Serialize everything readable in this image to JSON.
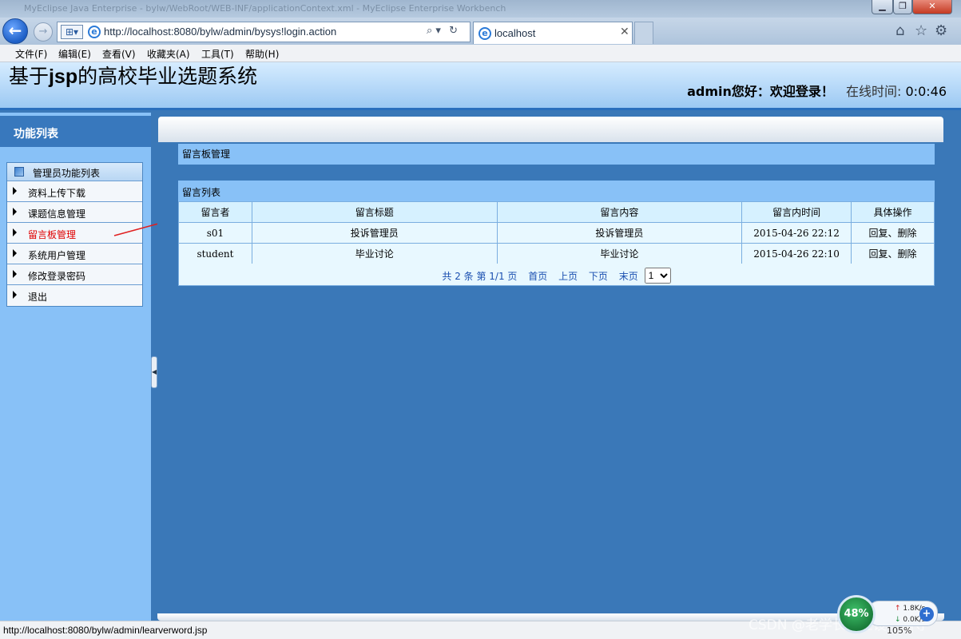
{
  "browser": {
    "window_title": "MyEclipse Java Enterprise - bylw/WebRoot/WEB-INF/applicationContext.xml - MyEclipse Enterprise Workbench",
    "address": "http://localhost:8080/bylw/admin/bysys!login.action",
    "tab_title": "localhost",
    "status_url": "http://localhost:8080/bylw/admin/learverword.jsp",
    "zoom": "105%",
    "menu": [
      "文件(F)",
      "编辑(E)",
      "查看(V)",
      "收藏夹(A)",
      "工具(T)",
      "帮助(H)"
    ]
  },
  "header": {
    "site_title_pre": "基于",
    "site_title_bold": "jsp",
    "site_title_post": "的高校毕业选题系统",
    "user": "admin",
    "greeting": "您好：欢迎登录！",
    "online_label": "在线时间:",
    "online_time": "0:0:46"
  },
  "sidebar": {
    "title": "功能列表",
    "group_label": "管理员功能列表",
    "items": [
      {
        "label": "资料上传下载",
        "active": false
      },
      {
        "label": "课题信息管理",
        "active": false
      },
      {
        "label": "留言板管理",
        "active": true
      },
      {
        "label": "系统用户管理",
        "active": false
      },
      {
        "label": "修改登录密码",
        "active": false
      },
      {
        "label": "退出",
        "active": false
      }
    ]
  },
  "main": {
    "section_title": "留言板管理",
    "list_title": "留言列表",
    "columns": [
      "留言者",
      "留言标题",
      "留言内容",
      "留言内时间",
      "具体操作"
    ],
    "rows": [
      {
        "author": "s01",
        "title": "投诉管理员",
        "content": "投诉管理员",
        "time": "2015-04-26 22:12",
        "reply": "回复",
        "sep": "、",
        "delete": "删除"
      },
      {
        "author": "student",
        "title": "毕业讨论",
        "content": "毕业讨论",
        "time": "2015-04-26 22:10",
        "reply": "回复",
        "sep": "、",
        "delete": "删除"
      }
    ],
    "pager": {
      "info": "共 2 条 第 1/1 页",
      "first": "首页",
      "prev": "上页",
      "next": "下页",
      "last": "末页",
      "page_select": "1"
    }
  },
  "overlay": {
    "net_percent": "48%",
    "net_up": "1.8K/s",
    "net_down": "0.0K/s",
    "watermark": "CSDN @老学长毕业设计辅导"
  }
}
